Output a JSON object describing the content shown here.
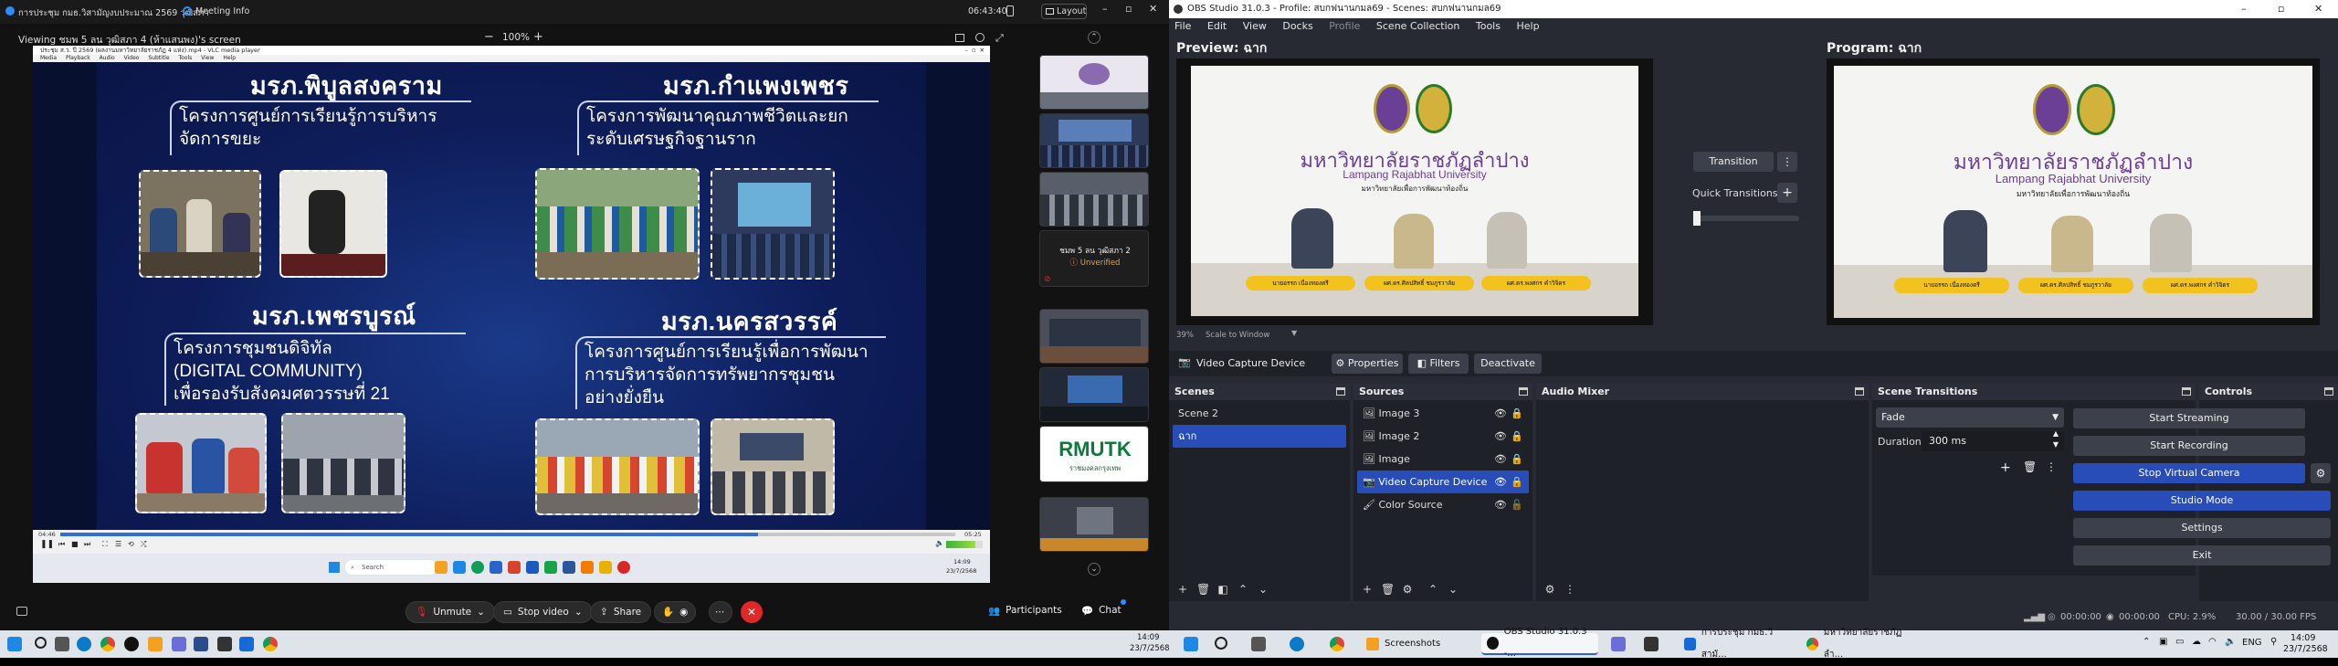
{
  "meeting": {
    "window_tabs": [
      {
        "label": "การประชุม กมธ.วิสามัญงบประมาณ 2569 วุฒิสภา"
      },
      {
        "label": "Meeting Info"
      }
    ],
    "clock": "06:43:40",
    "layout_label": "Layout",
    "viewing_text": "Viewing ชมพ 5 ลน วุฒิสภา 4 (ห้าแสนพง)'s screen",
    "zoom_minus": "−",
    "zoom_level": "100%",
    "zoom_plus": "+",
    "participants_label": "Participants",
    "chat_label": "Chat",
    "unmute_label": "Unmute",
    "stop_video_label": "Stop video",
    "share_label": "Share",
    "thumb_tile_name": "ชมพ 5 ลน วุฒิสภา 2",
    "thumb_tile_status": "Unverified",
    "thumb_logo_text": "RMUTK",
    "thumb_logo_sub": "ราชมงคลกรุงเทพ"
  },
  "vlc": {
    "title": "ประชุม ส.ว. ปี 2569 (ผลงานมหาวิทยาลัยราชภัฏ 4 แห่ง).mp4 - VLC media player",
    "menu": [
      "Media",
      "Playback",
      "Audio",
      "Video",
      "Subtitle",
      "Tools",
      "View",
      "Help"
    ],
    "time_elapsed": "04:46",
    "time_total": "05:25",
    "progress": 0.78,
    "volume": 0.8,
    "inner_search": "Search",
    "inner_clock": "14:09",
    "inner_date": "23/7/2568"
  },
  "slide": {
    "q1_head": "มรภ.พิบูลสงคราม",
    "q1_text": [
      "โครงการศูนย์การเรียนรู้การบริหาร",
      "จัดการขยะ"
    ],
    "q2_head": "มรภ.กำแพงเพชร",
    "q2_text": [
      "โครงการพัฒนาคุณภาพชีวิตและยก",
      "ระดับเศรษฐกิจฐานราก"
    ],
    "q3_head": "มรภ.เพชรบูรณ์",
    "q3_text": [
      "โครงการชุมชนดิจิทัล",
      "(DIGITAL COMMUNITY)",
      "เพื่อรองรับสังคมศตวรรษที่ 21"
    ],
    "q4_head": "มรภ.นครสวรรค์",
    "q4_text": [
      "โครงการศูนย์การเรียนรู้เพื่อการพัฒนา",
      "การบริหารจัดการทรัพยากรชุมชน",
      "อย่างยั่งยืน"
    ]
  },
  "obs": {
    "title": "OBS Studio 31.0.3 - Profile: สบกฟนานกมล69 - Scenes: สบกฟนานกมล69",
    "menu": [
      "File",
      "Edit",
      "View",
      "Docks",
      "Profile",
      "Scene Collection",
      "Tools",
      "Help"
    ],
    "preview_label": "Preview: ฉาก",
    "program_label": "Program: ฉาก",
    "transition_label": "Transition",
    "quick_transitions_label": "Quick Transitions",
    "scale_text": "39%",
    "scale_label": "Scale to Window",
    "university_th": "มหาวิทยาลัยราชภัฏลำปาง",
    "university_en": "Lampang Rajabhat University",
    "university_motto": "มหาวิทยาลัยเพื่อการพัฒนาท้องถิ่น",
    "nameplates": [
      "นายอรรถ เนื่องทองตรี",
      "ผศ.ดร.ศิลปสิทธิ์ ชมภูรวาลัย",
      "ผศ.ดร.พงศกร คำวิจิตร"
    ],
    "source_toolbar": {
      "device": "Video Capture Device",
      "properties": "Properties",
      "filters": "Filters",
      "deactivate": "Deactivate"
    },
    "docks": {
      "scenes_title": "Scenes",
      "sources_title": "Sources",
      "mixer_title": "Audio Mixer",
      "transitions_title": "Scene Transitions",
      "controls_title": "Controls"
    },
    "scenes": [
      {
        "name": "Scene 2",
        "selected": false
      },
      {
        "name": "ฉาก",
        "selected": true
      }
    ],
    "sources": [
      {
        "name": "Image 3",
        "icon": "image-icon",
        "selected": false
      },
      {
        "name": "Image 2",
        "icon": "image-icon",
        "selected": false
      },
      {
        "name": "Image",
        "icon": "image-icon",
        "selected": false
      },
      {
        "name": "Video Capture Device",
        "icon": "camera-icon",
        "selected": true
      },
      {
        "name": "Color Source",
        "icon": "brush-icon",
        "selected": false
      }
    ],
    "transition_select": "Fade",
    "duration_label": "Duration",
    "duration_value": "300 ms",
    "controls": [
      "Start Streaming",
      "Start Recording",
      "Stop Virtual Camera",
      "Studio Mode",
      "Settings",
      "Exit"
    ],
    "status": {
      "stream_time": "00:00:00",
      "rec_time": "00:00:00",
      "cpu": "CPU: 2.9%",
      "fps": "30.00 / 30.00 FPS"
    }
  },
  "taskbar": {
    "apps": [
      {
        "label": "Screenshots"
      },
      {
        "label": "OBS Studio 31.0.3 -..."
      },
      {
        "label": "การประชุม กมธ.วิสามั..."
      },
      {
        "label": "มหาวิทยาลัยราชภัฏลำ..."
      }
    ],
    "language": "ENG",
    "time": "14:09",
    "date": "23/7/2568",
    "left_time": "14:09",
    "left_date": "23/7/2568"
  },
  "colors": {
    "obs_accent": "#284cb8",
    "slide_bg": "#0c1747",
    "leave_red": "#e02828"
  }
}
